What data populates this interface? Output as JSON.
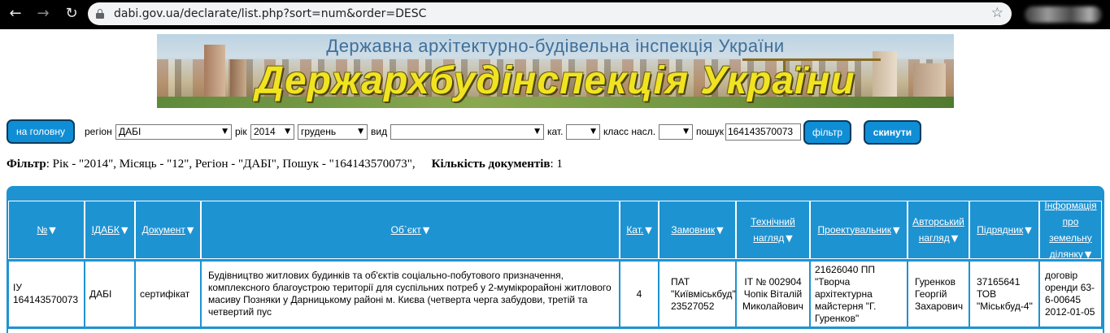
{
  "browser": {
    "url": "dabi.gov.ua/declarate/list.php?sort=num&order=DESC",
    "back_glyph": "←",
    "forward_glyph": "→",
    "reload_glyph": "↻",
    "star_glyph": "☆",
    "icons": [
      "back-icon",
      "forward-icon",
      "reload-icon",
      "lock-icon",
      "star-icon"
    ]
  },
  "banner": {
    "subtitle": "Державна архітектурно-будівельна інспекція України",
    "title": "Держархбудінспекція України"
  },
  "filters": {
    "home_button": "на головну",
    "region_label": "регіон",
    "region_value": "ДАБІ",
    "year_label": "рік",
    "year_value": "2014",
    "month_value": "грудень",
    "type_label": "вид",
    "type_value": "",
    "category_label": "кат.",
    "category_value": "",
    "class_label": "класс насл.",
    "class_value": "",
    "search_label": "пошук",
    "search_value": "164143570073",
    "filter_button": "фільтр",
    "reset_button": "скинути",
    "dropdown_glyph": "▼"
  },
  "summary": {
    "filter_label": "Фільтр",
    "filter_text": ": Рік - \"2014\", Місяць - \"12\", Регіон - \"ДАБІ\", Пошук - \"164143570073\",",
    "count_label": "Кількість документів",
    "count_text": ": 1"
  },
  "table": {
    "sort_glyph": "▼",
    "headers": [
      {
        "label": "№"
      },
      {
        "label": "ІДАБК"
      },
      {
        "label": "Документ"
      },
      {
        "label": "Об`єкт"
      },
      {
        "label": "Кат."
      },
      {
        "label": "Замовник"
      },
      {
        "label": "Технічний нагляд"
      },
      {
        "label": "Проектувальник"
      },
      {
        "label": "Авторський нагляд"
      },
      {
        "label": "Підрядник"
      },
      {
        "label": "Інформація про земельну ділянку"
      }
    ],
    "rows": [
      {
        "num": "ІУ 164143570073",
        "idabk": "ДАБІ",
        "doc": "сертифікат",
        "object": "Будівництво житлових будинків та об'єктів соціально-побутового призначення, комплексного благоустрою території для суспільних потреб у 2-мумікрорайоні житлового масиву Позняки у Дарницькому районі м. Києва (четверта черга забудови, третій та четвертий пус",
        "cat": "4",
        "customer": "ПАТ \"Київміськбуд\" 23527052",
        "tech_supervision": "ІТ № 002904 Чопік Віталій Миколайович",
        "designer": "21626040 ПП \"Творча архітектурна майстерня \"Г. Гуренков\"",
        "author_supervision": "Гуренков Георгій Захарович",
        "contractor": "37165641 ТОВ \"Міськбуд-4\"",
        "land_info": "договір оренди 63-6-00645 2012-01-05"
      }
    ]
  }
}
